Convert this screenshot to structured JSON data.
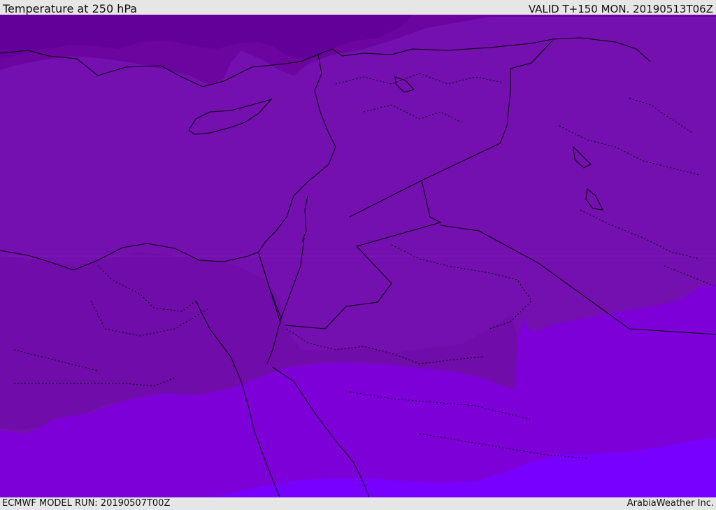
{
  "header": {
    "title": "Temperature at 250 hPa",
    "valid_time": "VALID T+150 MON. 20190513T06Z"
  },
  "footer": {
    "model_run": "ECMWF MODEL RUN: 20190507T00Z",
    "brand": "ArabiaWeather Inc."
  },
  "map": {
    "region": "Eastern Mediterranean and Middle East",
    "field": "250 hPa temperature shading",
    "colors": {
      "coldest_north": "#64009a",
      "cold_band": "#6c04a0",
      "main_field": "#7410b0",
      "egypt_band": "#700caa",
      "warm_south": "#7e00d8",
      "warmest_south": "#7800ff",
      "coastline": "#000000"
    }
  }
}
